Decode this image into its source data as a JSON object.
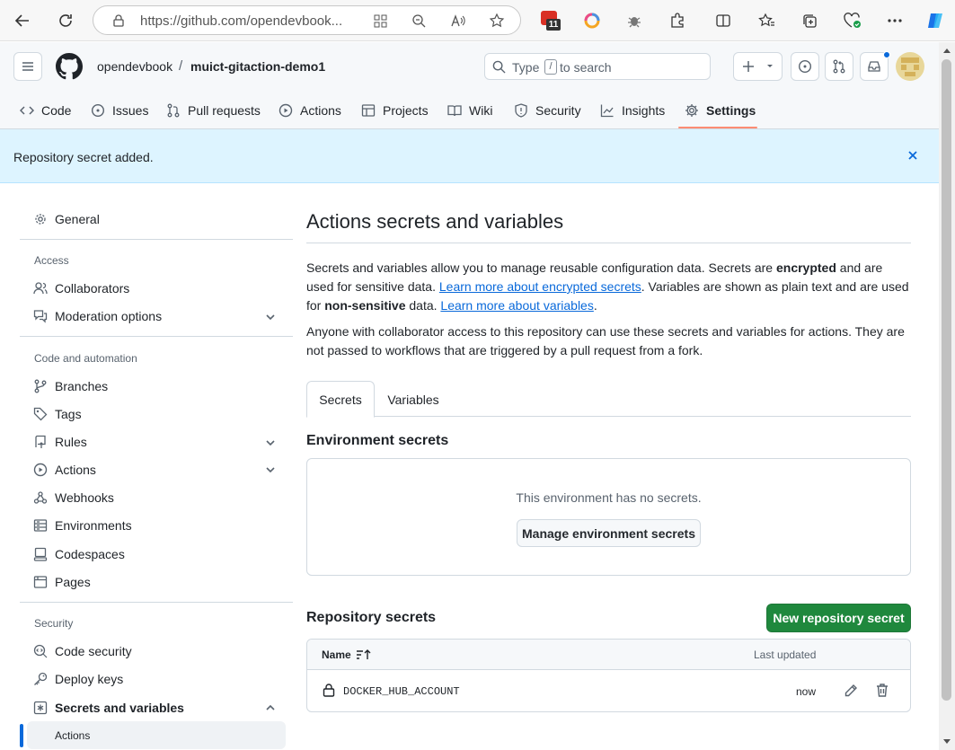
{
  "browser": {
    "url": "https://github.com/opendevbook...",
    "badge_count": "11"
  },
  "header": {
    "owner": "opendevbook",
    "separator": "/",
    "repo": "muict-gitaction-demo1",
    "search_prefix": "Type",
    "search_key": "/",
    "search_suffix": "to search"
  },
  "repo_nav": {
    "items": [
      {
        "label": "Code",
        "icon": "code-icon"
      },
      {
        "label": "Issues",
        "icon": "issue-icon"
      },
      {
        "label": "Pull requests",
        "icon": "pull-request-icon"
      },
      {
        "label": "Actions",
        "icon": "play-icon"
      },
      {
        "label": "Projects",
        "icon": "table-icon"
      },
      {
        "label": "Wiki",
        "icon": "book-icon"
      },
      {
        "label": "Security",
        "icon": "shield-icon"
      },
      {
        "label": "Insights",
        "icon": "graph-icon"
      },
      {
        "label": "Settings",
        "icon": "gear-icon"
      }
    ],
    "active": "Settings"
  },
  "flash": {
    "message": "Repository secret added."
  },
  "sidebar": {
    "general": "General",
    "access_heading": "Access",
    "access_items": [
      "Collaborators",
      "Moderation options"
    ],
    "code_heading": "Code and automation",
    "code_items": [
      "Branches",
      "Tags",
      "Rules",
      "Actions",
      "Webhooks",
      "Environments",
      "Codespaces",
      "Pages"
    ],
    "security_heading": "Security",
    "security_items": [
      "Code security",
      "Deploy keys",
      "Secrets and variables"
    ],
    "sub_items": [
      "Actions"
    ]
  },
  "main": {
    "title": "Actions secrets and variables",
    "para1_a": "Secrets and variables allow you to manage reusable configuration data. Secrets are ",
    "para1_bold1": "encrypted",
    "para1_b": " and are used for sensitive data. ",
    "para1_link1": "Learn more about encrypted secrets",
    "para1_c": ". Variables are shown as plain text and are used for ",
    "para1_bold2": "non-sensitive",
    "para1_d": " data. ",
    "para1_link2": "Learn more about variables",
    "para1_e": ".",
    "para2": "Anyone with collaborator access to this repository can use these secrets and variables for actions. They are not passed to workflows that are triggered by a pull request from a fork.",
    "tabs": [
      "Secrets",
      "Variables"
    ],
    "active_tab": "Secrets",
    "env_heading": "Environment secrets",
    "env_empty": "This environment has no secrets.",
    "env_button": "Manage environment secrets",
    "repo_heading": "Repository secrets",
    "new_secret_button": "New repository secret",
    "table": {
      "col_name": "Name",
      "col_updated": "Last updated",
      "rows": [
        {
          "name": "DOCKER_HUB_ACCOUNT",
          "updated": "now"
        }
      ]
    }
  },
  "colors": {
    "accent": "#0969da",
    "green": "#1f883d",
    "flash_bg": "#ddf4ff",
    "underline": "#fd8c73"
  }
}
